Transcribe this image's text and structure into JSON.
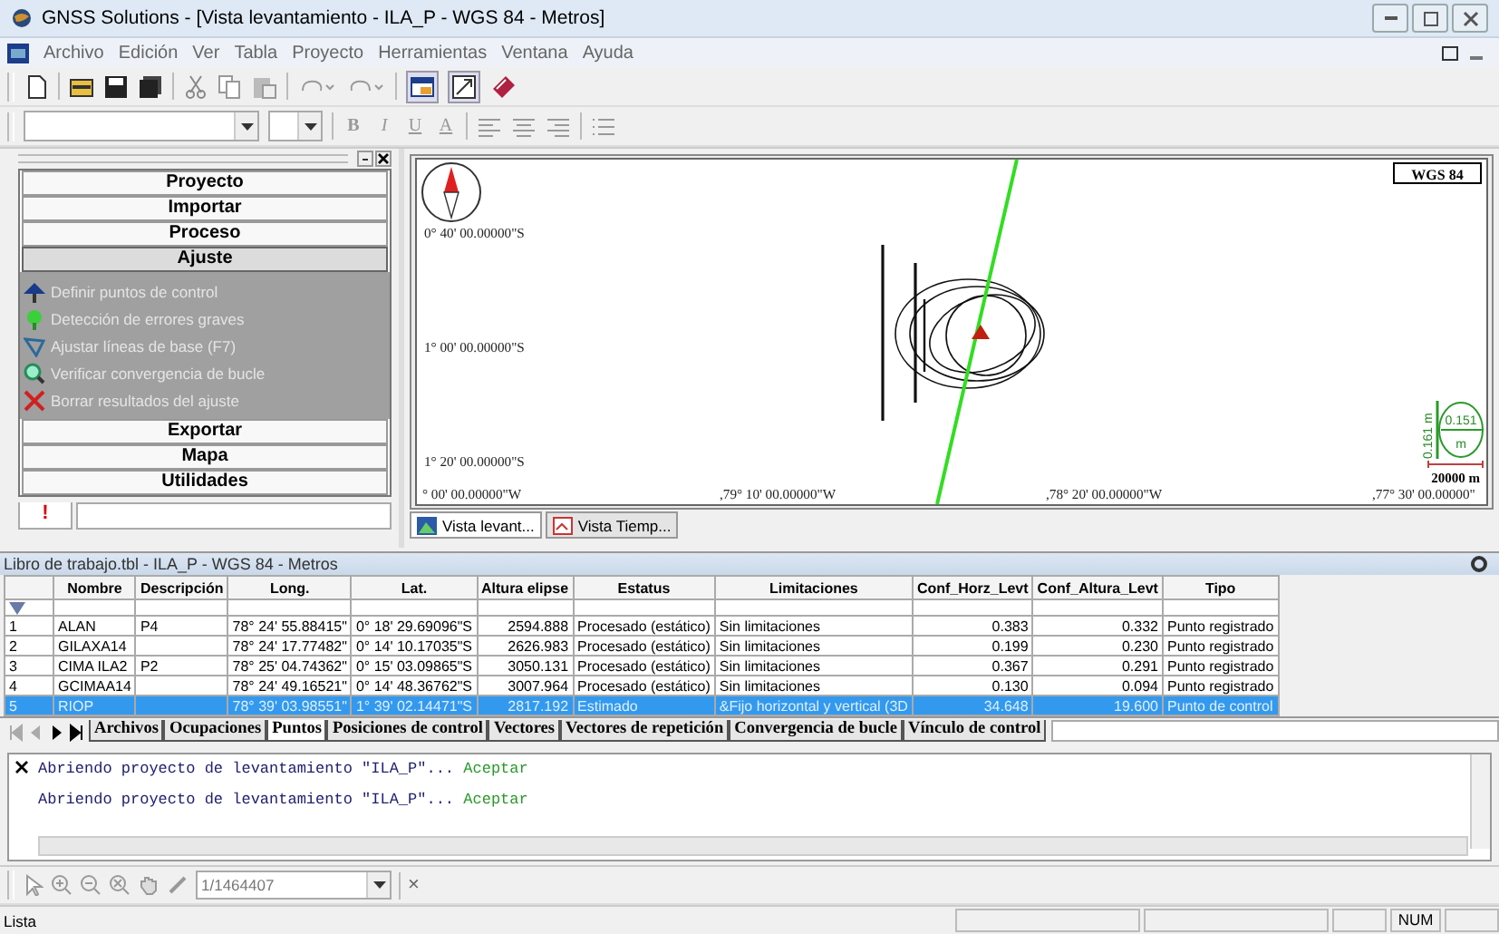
{
  "window": {
    "title": "GNSS Solutions - [Vista levantamiento - ILA_P - WGS 84 - Metros]"
  },
  "menu": [
    "Archivo",
    "Edición",
    "Ver",
    "Tabla",
    "Proyecto",
    "Herramientas",
    "Ventana",
    "Ayuda"
  ],
  "format_buttons": [
    "B",
    "I",
    "U",
    "A"
  ],
  "sidebar": {
    "sections": [
      {
        "label": "Proyecto",
        "expanded": false
      },
      {
        "label": "Importar",
        "expanded": false
      },
      {
        "label": "Proceso",
        "expanded": false
      },
      {
        "label": "Ajuste",
        "expanded": true,
        "items": [
          {
            "label": "Definir puntos de control",
            "kind": "control"
          },
          {
            "label": "Detección de errores graves",
            "kind": "errors"
          },
          {
            "label": "Ajustar líneas de base (F7)",
            "kind": "baselines"
          },
          {
            "label": "Verificar convergencia de bucle",
            "kind": "loop"
          },
          {
            "label": "Borrar resultados del ajuste",
            "kind": "delete"
          }
        ]
      },
      {
        "label": "Exportar",
        "expanded": false
      },
      {
        "label": "Mapa",
        "expanded": false
      },
      {
        "label": "Utilidades",
        "expanded": false
      }
    ],
    "alert_tab": "!"
  },
  "map": {
    "datum": "WGS 84",
    "lat_labels": [
      "0° 40' 00.00000\"S",
      "1° 00' 00.00000\"S",
      "1° 20' 00.00000\"S"
    ],
    "lon_labels": [
      "° 00' 00.00000\"W",
      ",79° 10' 00.00000\"W",
      ",78° 20' 00.00000\"W",
      ",77° 30' 00.00000\""
    ],
    "ellipse_scale": {
      "horizontal": "0.151",
      "unit": "m",
      "vertical": "0.161 m"
    },
    "scale_bar": "20000 m",
    "tabs": [
      {
        "label": "Vista levant...",
        "selected": true
      },
      {
        "label": "Vista Tiemp...",
        "selected": false
      }
    ]
  },
  "workbook": {
    "title": "Libro de trabajo.tbl - ILA_P - WGS 84 - Metros",
    "columns": [
      {
        "label": "Nombre",
        "kind": "text"
      },
      {
        "label": "Descripción",
        "kind": "text"
      },
      {
        "label": "Long.",
        "kind": "number"
      },
      {
        "label": "Lat.",
        "kind": "number"
      },
      {
        "label": "Altura elipse",
        "kind": "number"
      },
      {
        "label": "Estatus",
        "kind": "text"
      },
      {
        "label": "Limitaciones",
        "kind": "text"
      },
      {
        "label": "Conf_Horz_Levt",
        "kind": "number"
      },
      {
        "label": "Conf_Altura_Levt",
        "kind": "number"
      },
      {
        "label": "Tipo",
        "kind": "text"
      }
    ],
    "rows": [
      {
        "index": "1",
        "selected": false,
        "cells": [
          "ALAN",
          "P4",
          "78° 24' 55.88415\"",
          "0° 18' 29.69096\"S",
          "2594.888",
          "Procesado (estático)",
          "Sin limitaciones",
          "0.383",
          "0.332",
          "Punto registrado"
        ]
      },
      {
        "index": "2",
        "selected": false,
        "cells": [
          "GILAXA14",
          "",
          "78° 24' 17.77482\"",
          "0° 14' 10.17035\"S",
          "2626.983",
          "Procesado (estático)",
          "Sin limitaciones",
          "0.199",
          "0.230",
          "Punto registrado"
        ]
      },
      {
        "index": "3",
        "selected": false,
        "cells": [
          "CIMA ILA2",
          "P2",
          "78° 25' 04.74362\"",
          "0° 15' 03.09865\"S",
          "3050.131",
          "Procesado (estático)",
          "Sin limitaciones",
          "0.367",
          "0.291",
          "Punto registrado"
        ]
      },
      {
        "index": "4",
        "selected": false,
        "cells": [
          "GCIMAA14",
          "",
          "78° 24' 49.16521\"",
          "0° 14' 48.36762\"S",
          "3007.964",
          "Procesado (estático)",
          "Sin limitaciones",
          "0.130",
          "0.094",
          "Punto registrado"
        ]
      },
      {
        "index": "5",
        "selected": true,
        "cells": [
          "RIOP",
          "",
          "78° 39' 03.98551\"",
          "1° 39' 02.14471\"S",
          "2817.192",
          "Estimado",
          "&Fijo horizontal y vertical (3D",
          "34.648",
          "19.600",
          "Punto de control"
        ]
      }
    ],
    "sheet_tabs": [
      {
        "label": "Archivos",
        "selected": false
      },
      {
        "label": "Ocupaciones",
        "selected": false
      },
      {
        "label": "Puntos",
        "selected": true
      },
      {
        "label": "Posiciones de control",
        "selected": false
      },
      {
        "label": "Vectores",
        "selected": false
      },
      {
        "label": "Vectores de repetición",
        "selected": false
      },
      {
        "label": "Convergencia de bucle",
        "selected": false
      },
      {
        "label": "Vínculo de control",
        "selected": false
      }
    ]
  },
  "log": [
    {
      "text": "Abriendo proyecto de levantamiento \"ILA_P\"...",
      "status": "Aceptar"
    },
    {
      "text": "Abriendo proyecto de levantamiento \"ILA_P\"...",
      "status": "Aceptar"
    }
  ],
  "map_toolbar": {
    "scale": "1/1464407",
    "close": "×"
  },
  "status_bar": {
    "message": "Lista",
    "indicator": "NUM"
  }
}
